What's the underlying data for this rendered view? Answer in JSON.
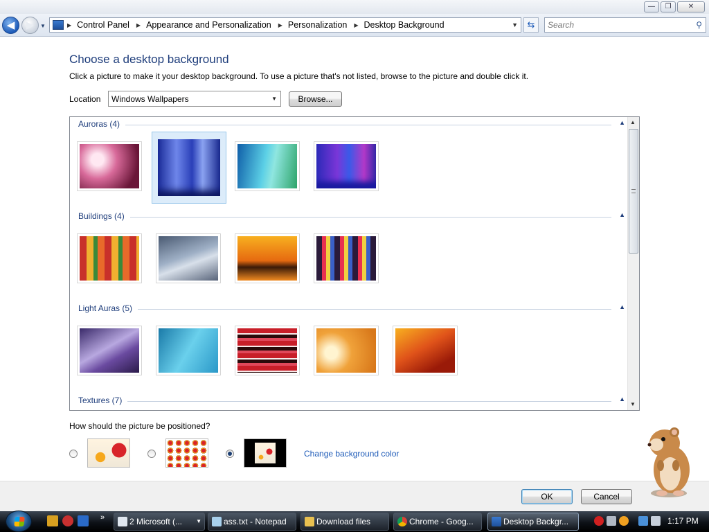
{
  "window": {
    "minimize_glyph": "—",
    "maximize_glyph": "❐",
    "close_glyph": "✕"
  },
  "navigation": {
    "back_glyph": "◀",
    "forward_glyph": "▶",
    "recent_glyph": "▼",
    "crumb_sep": "▶",
    "crumbs": [
      "Control Panel",
      "Appearance and Personalization",
      "Personalization",
      "Desktop Background"
    ],
    "address_dropdown_glyph": "▼",
    "refresh_glyph": "⇆",
    "search_placeholder": "Search",
    "search_glyph": "⚲"
  },
  "content": {
    "title": "Choose a desktop background",
    "instructions": "Click a picture to make it your desktop background. To use a picture that's not listed, browse to the picture and double click it.",
    "location_label": "Location",
    "location_value": "Windows Wallpapers",
    "location_arrow": "▼",
    "browse_label": "Browse...",
    "collapse_glyph": "▲",
    "groups": [
      {
        "title": "Auroras (4)",
        "colors": [
          "#f2c4d8",
          "#2f46b8",
          "#4ec6d8",
          "#5a3ec8"
        ],
        "selected_index": 1
      },
      {
        "title": "Buildings (4)",
        "colors": [
          "#d9582f",
          "#7f91a8",
          "#e57b1a",
          "#b8325a"
        ]
      },
      {
        "title": "Light Auras (5)",
        "colors": [
          "#6b4a9c",
          "#3ea6cf",
          "#c81e28",
          "#f0a23a",
          "#e0531a"
        ]
      },
      {
        "title": "Textures (7)"
      }
    ],
    "scroll_up": "▲",
    "scroll_down": "▼",
    "position_question": "How should the picture be positioned?",
    "position_options": [
      "fill",
      "tile",
      "center"
    ],
    "position_selected": "center",
    "change_color_label": "Change background color"
  },
  "footer": {
    "ok_label": "OK",
    "cancel_label": "Cancel"
  },
  "taskbar": {
    "more_glyph": "»",
    "buttons": [
      {
        "label": "2 Microsoft (...",
        "caret": "▼"
      },
      {
        "label": "ass.txt - Notepad"
      },
      {
        "label": "Download files"
      },
      {
        "label": "Chrome - Goog..."
      },
      {
        "label": "Desktop Backgr...",
        "active": true
      }
    ],
    "clock": "1:17 PM"
  },
  "colors": {
    "accent_blue": "#1e3d7b",
    "link_blue": "#1e5bb8",
    "selection_bg": "#dcecfa"
  }
}
